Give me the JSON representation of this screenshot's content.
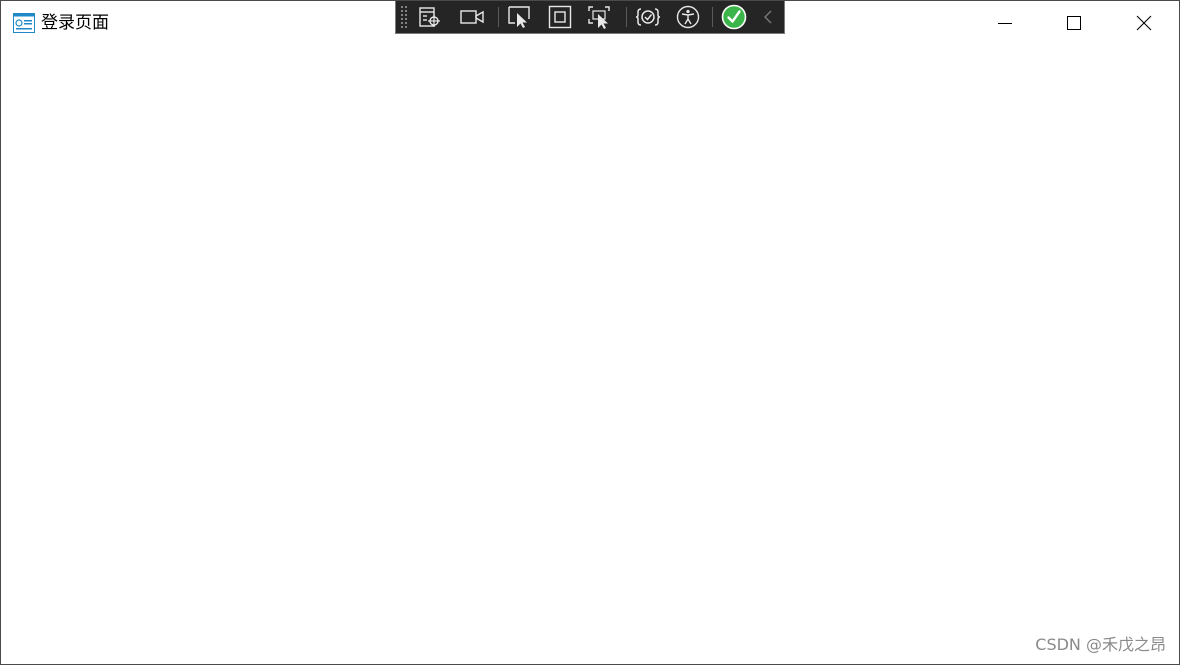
{
  "window": {
    "title": "登录页面",
    "controls": {
      "minimize": "minimize",
      "maximize": "maximize",
      "close": "close"
    }
  },
  "debug_toolbar": {
    "tools": [
      "go-to-live-visual-tree-icon",
      "record-icon",
      "select-element-icon",
      "display-layout-adorners-icon",
      "track-focused-element-icon",
      "hot-reload-icon",
      "accessibility-icon",
      "hot-reload-status-ok-icon",
      "collapse-chevron-icon"
    ],
    "status_color": "#3bb54a"
  },
  "watermark": "CSDN @禾戊之昂"
}
